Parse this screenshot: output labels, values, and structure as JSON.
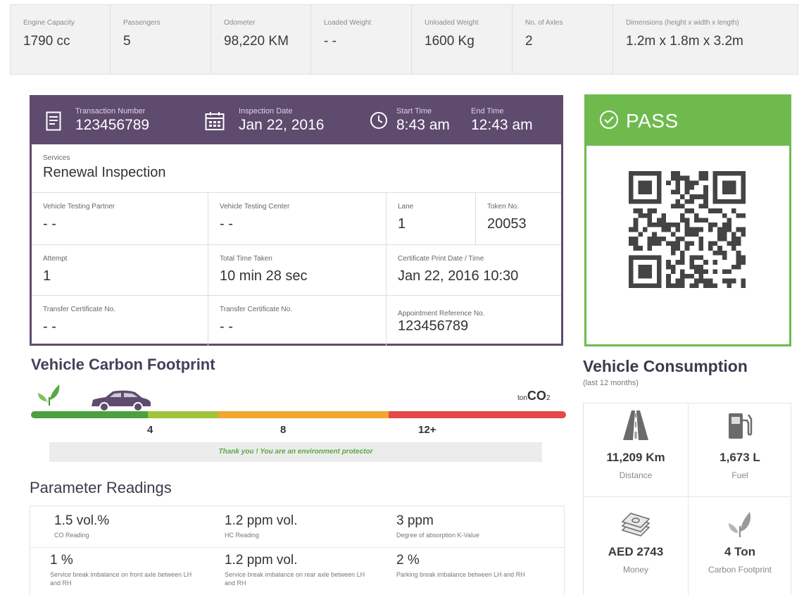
{
  "specs": [
    {
      "label": "Engine Capacity",
      "value": "1790 cc"
    },
    {
      "label": "Passengers",
      "value": "5"
    },
    {
      "label": "Odometer",
      "value": "98,220 KM"
    },
    {
      "label": "Loaded Weight",
      "value": "- -"
    },
    {
      "label": "Unloaded Weight",
      "value": "1600 Kg"
    },
    {
      "label": "No. of Axles",
      "value": "2"
    },
    {
      "label": "Dimensions (height x width x length)",
      "value": "1.2m x 1.8m x 3.2m"
    }
  ],
  "inspection": {
    "transaction": {
      "label": "Transaction Number",
      "value": "123456789"
    },
    "inspection_date": {
      "label": "Inspection Date",
      "value": "Jan 22, 2016"
    },
    "start_time": {
      "label": "Start Time",
      "value": "8:43 am"
    },
    "end_time": {
      "label": "End Time",
      "value": "12:43 am"
    },
    "services": {
      "label": "Services",
      "value": "Renewal Inspection"
    },
    "partner": {
      "label": "Vehicle Testing Partner",
      "value": "- -"
    },
    "center": {
      "label": "Vehicle Testing Center",
      "value": "- -"
    },
    "lane": {
      "label": "Lane",
      "value": "1"
    },
    "token": {
      "label": "Token No.",
      "value": "20053"
    },
    "attempt": {
      "label": "Attempt",
      "value": "1"
    },
    "total_time": {
      "label": "Total Time Taken",
      "value": "10 min 28 sec"
    },
    "cert_print": {
      "label": "Certificate Print Date / Time",
      "value": "Jan 22, 2016 10:30"
    },
    "transfer1": {
      "label": "Transfer Certificate No.",
      "value": "- -"
    },
    "transfer2": {
      "label": "Transfer Certificate No.",
      "value": "- -"
    },
    "appointment": {
      "label": "Appointment Reference No.",
      "value": "123456789"
    }
  },
  "status": {
    "text": "PASS",
    "color": "#6fba4d"
  },
  "carbon": {
    "title": "Vehicle Carbon Footprint",
    "unit_prefix": "ton",
    "unit": "CO",
    "unit_sub": "2",
    "ticks": [
      "4",
      "8",
      "12+"
    ],
    "message": "Thank you ! You are an environment protector",
    "segments": [
      "#4aa13f",
      "#a2c33c",
      "#f0a72b",
      "#e5484a"
    ]
  },
  "readings": {
    "title": "Parameter Readings",
    "items": [
      {
        "value": "1.5 vol.%",
        "label": "CO Reading"
      },
      {
        "value": "1.2 ppm vol.",
        "label": "HC Reading"
      },
      {
        "value": "3 ppm",
        "label": "Degree of absorption K-Value"
      },
      {
        "value": "1 %",
        "label": "Service break imbalance on front axle between LH and RH"
      },
      {
        "value": "1.2 ppm vol.",
        "label": "Service break imbalance on rear axle between LH and RH"
      },
      {
        "value": "2 %",
        "label": "Parking break imbalance between LH and RH"
      }
    ]
  },
  "consumption": {
    "title": "Vehicle Consumption",
    "subtitle": "(last 12 months)",
    "items": [
      {
        "value": "11,209 Km",
        "label": "Distance",
        "icon": "road-icon"
      },
      {
        "value": "1,673 L",
        "label": "Fuel",
        "icon": "fuel-pump-icon"
      },
      {
        "value": "AED 2743",
        "label": "Money",
        "icon": "money-stack-icon"
      },
      {
        "value": "4 Ton",
        "label": "Carbon Footprint",
        "icon": "leaf-icon"
      }
    ]
  }
}
